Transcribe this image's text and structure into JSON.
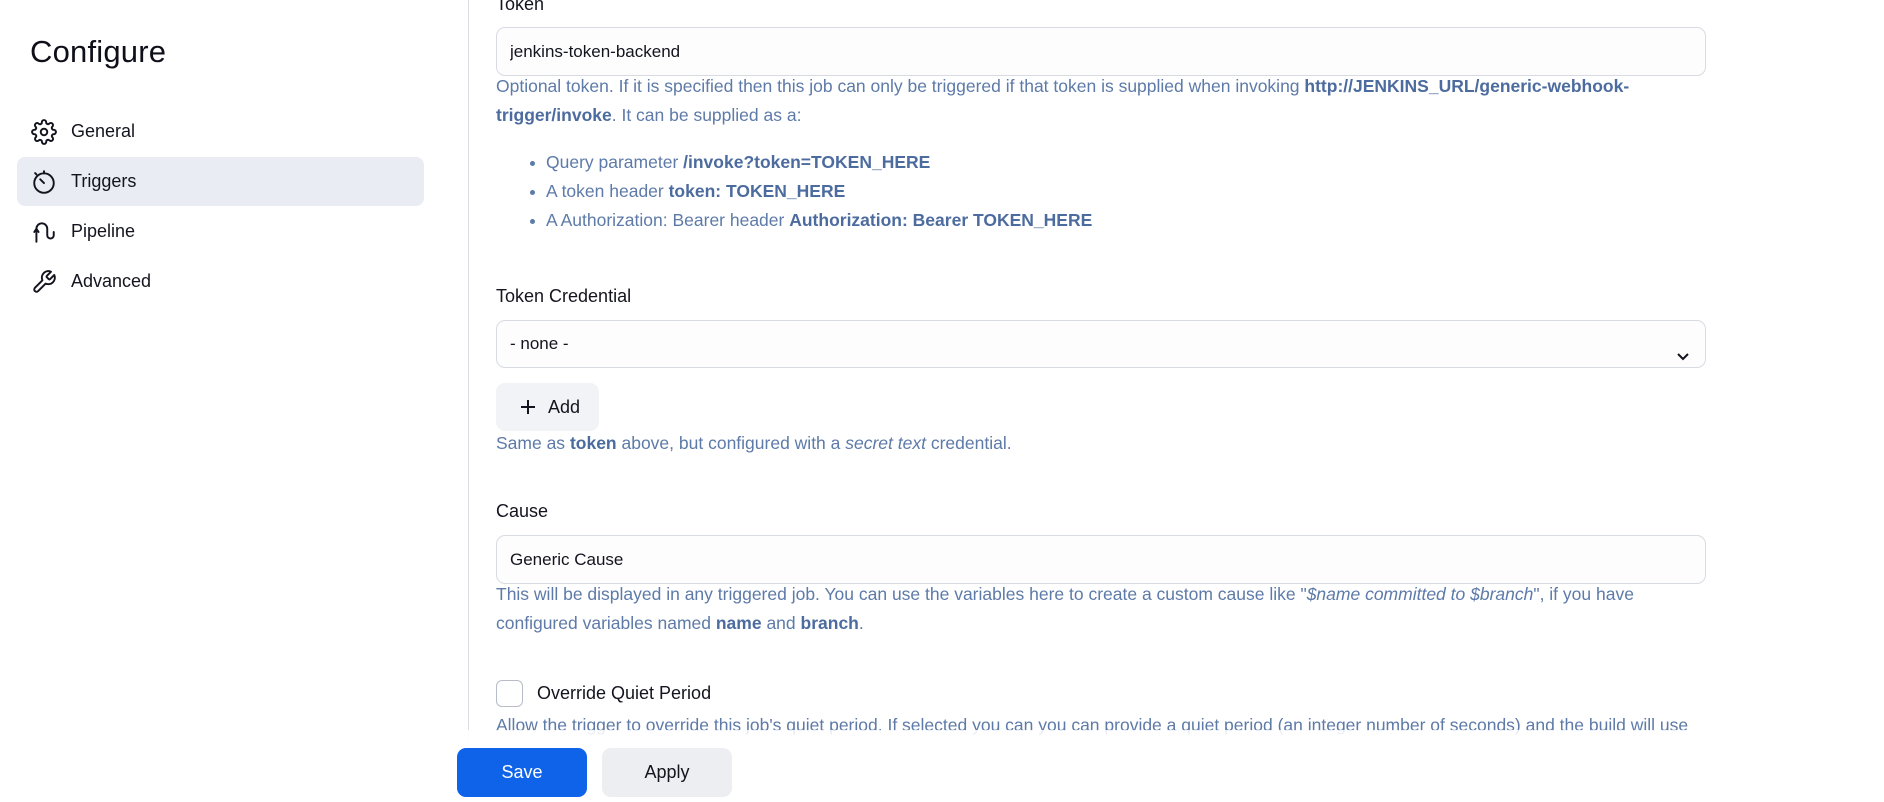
{
  "sidebar": {
    "title": "Configure",
    "items": [
      {
        "label": "General",
        "icon": "gear-icon",
        "active": false
      },
      {
        "label": "Triggers",
        "icon": "stopwatch-icon",
        "active": true
      },
      {
        "label": "Pipeline",
        "icon": "pipeline-icon",
        "active": false
      },
      {
        "label": "Advanced",
        "icon": "wrench-icon",
        "active": false
      }
    ]
  },
  "token": {
    "label": "Token",
    "value": "jenkins-token-backend",
    "help_1": "Optional token. If it is specified then this job can only be triggered if that token is supplied when invoking ",
    "help_url_1": "http://JENKINS_URL/generic-webhook-",
    "help_url_2": "trigger/invoke",
    "help_2": ". It can be supplied as a:",
    "bullets": [
      {
        "text": "Query parameter ",
        "bold": "/invoke?token=TOKEN_HERE"
      },
      {
        "text": "A token header ",
        "bold": "token: TOKEN_HERE"
      },
      {
        "text": "A Authorization: Bearer header ",
        "bold": "Authorization: Bearer TOKEN_HERE"
      }
    ]
  },
  "token_credential": {
    "label": "Token Credential",
    "selected": "- none -",
    "add_label": "Add",
    "help_1": "Same as ",
    "help_bold": "token",
    "help_2": " above, but configured with a ",
    "help_italic": "secret text",
    "help_3": " credential."
  },
  "cause": {
    "label": "Cause",
    "value": "Generic Cause",
    "help_1": "This will be displayed in any triggered job. You can use the variables here to create a custom cause like \"",
    "help_italic": "$name committed to $branch",
    "help_2": "\", if you have",
    "help_3": "configured variables named ",
    "help_bold_1": "name",
    "help_4": " and ",
    "help_bold_2": "branch",
    "help_5": "."
  },
  "quiet_period": {
    "label": "Override Quiet Period",
    "checked": false,
    "help": "Allow the trigger to override this job's quiet period. If selected you can you can provide a quiet period (an integer number of seconds) and the build will use"
  },
  "footer": {
    "save_label": "Save",
    "apply_label": "Apply"
  },
  "colors": {
    "accent": "#0e63e8",
    "help_text": "#5d7aa8",
    "active_nav_bg": "#e9ecf2"
  }
}
